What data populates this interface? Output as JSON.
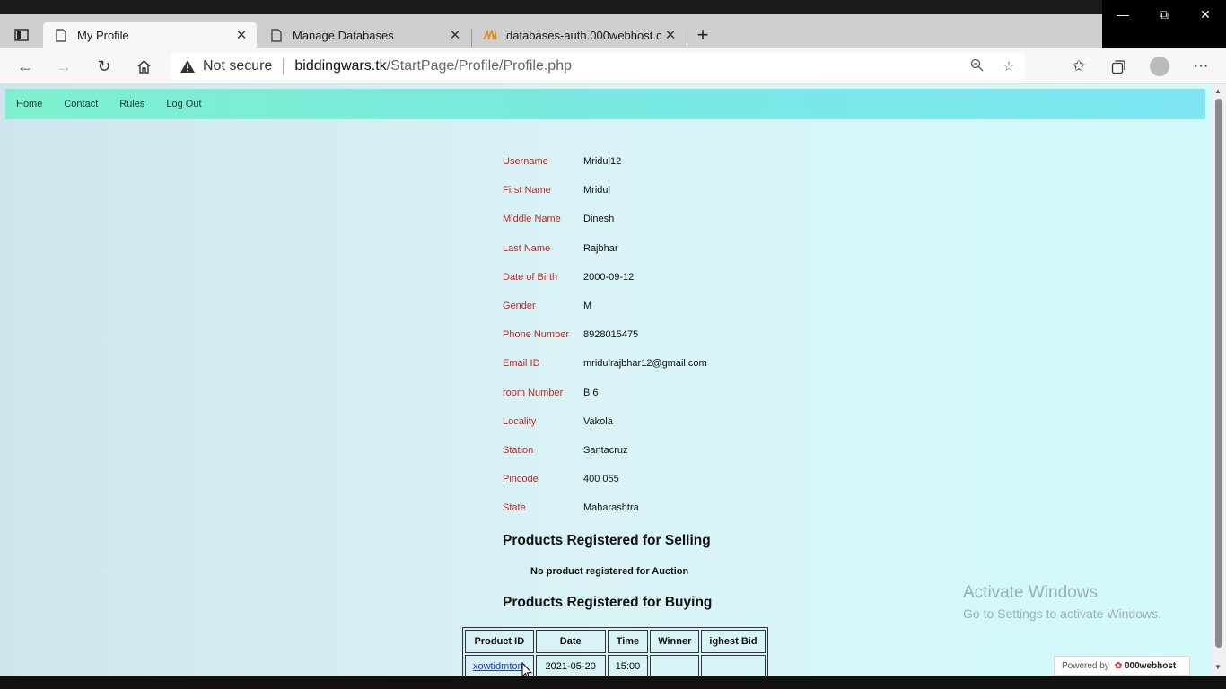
{
  "browser": {
    "tabs": [
      {
        "title": "My Profile",
        "active": true
      },
      {
        "title": "Manage Databases",
        "active": false
      },
      {
        "title": "databases-auth.000webhost.com",
        "active": false
      }
    ],
    "address": {
      "security": "Not secure",
      "host": "biddingwars.tk",
      "path": "/StartPage/Profile/Profile.php"
    }
  },
  "site_nav": [
    "Home",
    "Contact",
    "Rules",
    "Log Out"
  ],
  "profile": [
    {
      "label": "Username",
      "value": "Mridul12"
    },
    {
      "label": "First Name",
      "value": "Mridul"
    },
    {
      "label": "Middle Name",
      "value": "Dinesh"
    },
    {
      "label": "Last Name",
      "value": "Rajbhar"
    },
    {
      "label": "Date of Birth",
      "value": "2000-09-12"
    },
    {
      "label": "Gender",
      "value": "M"
    },
    {
      "label": "Phone Number",
      "value": "8928015475"
    },
    {
      "label": "Email ID",
      "value": "mridulrajbhar12@gmail.com"
    },
    {
      "label": "room Number",
      "value": "B 6"
    },
    {
      "label": "Locality",
      "value": "Vakola"
    },
    {
      "label": "Station",
      "value": "Santacruz"
    },
    {
      "label": "Pincode",
      "value": "400 055"
    },
    {
      "label": "State",
      "value": "Maharashtra"
    }
  ],
  "selling": {
    "heading": "Products Registered for Selling",
    "empty_message": "No product registered for Auction"
  },
  "buying": {
    "heading": "Products Registered for Buying",
    "columns": [
      "Product ID",
      "Date",
      "Time",
      "Winner",
      "ighest Bid"
    ],
    "rows": [
      {
        "product_id": "xowtidmtom",
        "date": "2021-05-20",
        "time": "15:00",
        "winner": "",
        "highest_bid": ""
      }
    ]
  },
  "watermark": {
    "line1": "Activate Windows",
    "line2": "Go to Settings to activate Windows."
  },
  "powered_by": {
    "prefix": "Powered by",
    "brand": "000webhost"
  }
}
